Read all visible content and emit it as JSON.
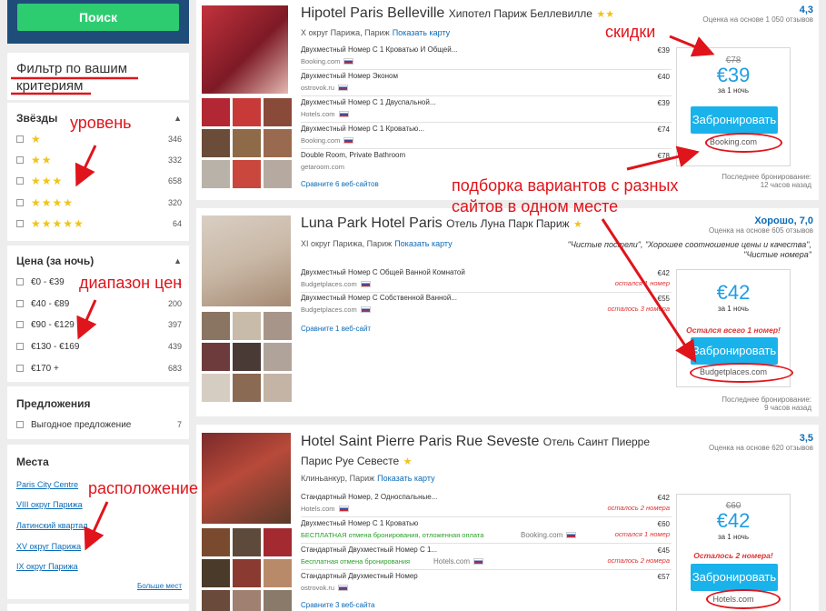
{
  "sidebar": {
    "search_label": "Поиск",
    "filter_title_1": "Фильтр по вашим",
    "filter_title_2": "критериям",
    "stars": {
      "title": "Звёзды",
      "items": [
        {
          "stars": "★",
          "count": "346"
        },
        {
          "stars": "★★",
          "count": "332"
        },
        {
          "stars": "★★★",
          "count": "658"
        },
        {
          "stars": "★★★★",
          "count": "320"
        },
        {
          "stars": "★★★★★",
          "count": "64"
        }
      ]
    },
    "price": {
      "title": "Цена (за ночь)",
      "items": [
        {
          "label": "€0 - €39",
          "count": "1"
        },
        {
          "label": "€40 - €89",
          "count": "200"
        },
        {
          "label": "€90 - €129",
          "count": "397"
        },
        {
          "label": "€130 - €169",
          "count": "439"
        },
        {
          "label": "€170 +",
          "count": "683"
        }
      ]
    },
    "offers": {
      "title": "Предложения",
      "items": [
        {
          "label": "Выгодное предложение",
          "count": "7"
        }
      ]
    },
    "places": {
      "title": "Места",
      "items": [
        "Paris City Centre",
        "VIII округ Парижа",
        "Латинский квартал",
        "XV округ Парижа",
        "IX округ Парижа"
      ],
      "more": "Больше мест"
    }
  },
  "hotels": [
    {
      "name": "Hipotel Paris Belleville",
      "name_ru": "Хипотел Париж Беллевилле",
      "stars": "★★",
      "location": "X округ Парижа, Париж",
      "map_link": "Показать карту",
      "rating": "4,3",
      "reviews": "Оценка на основе 1 050 отзывов",
      "offers": [
        {
          "name": "Двухместный Номер С 1 Кроватью И Общей...",
          "site": "Booking.com",
          "price": "€39"
        },
        {
          "name": "Двухместный Номер Эконом",
          "site": "ostrovok.ru",
          "price": "€40"
        },
        {
          "name": "Двухместный Номер С 1 Двуспальной...",
          "site": "Hotels.com",
          "price": "€39"
        },
        {
          "name": "Двухместный Номер С 1 Кроватью...",
          "site": "Booking.com",
          "price": "€74"
        },
        {
          "name": "Double Room, Private Bathroom",
          "site": "getaroom.com",
          "price": "€78"
        }
      ],
      "compare": "Сравните 6 веб-сайтов",
      "old_price": "€78",
      "price": "€39",
      "per_night": "за 1 ночь",
      "book_label": "Забронировать",
      "book_site": "Booking.com",
      "last_booking": "Последнее бронирование:",
      "last_booking_time": "12 часов назад"
    },
    {
      "name": "Luna Park Hotel Paris",
      "name_ru": "Отель Луна Парк Париж",
      "stars": "★",
      "location": "XI округ Парижа, Париж",
      "map_link": "Показать карту",
      "rating": "Хорошо, 7,0",
      "reviews": "Оценка на основе 605 отзывов",
      "quote": "\"Чистые постели\", \"Хорошее соотношение цены и качества\", \"Чистые номера\"",
      "offers": [
        {
          "name": "Двухместный Номер С Общей Ванной Комнатой",
          "site": "Budgetplaces.com",
          "price": "€42",
          "left": "остался 1 номер"
        },
        {
          "name": "Двухместный Номер С Собственной Ванной...",
          "site": "Budgetplaces.com",
          "price": "€55",
          "left": "осталось 3 номера"
        }
      ],
      "compare": "Сравните 1 веб-сайт",
      "price": "€42",
      "per_night": "за 1 ночь",
      "left_note": "Остался всего 1 номер!",
      "book_label": "Забронировать",
      "book_site": "Budgetplaces.com",
      "last_booking": "Последнее бронирование:",
      "last_booking_time": "9 часов назад"
    },
    {
      "name": "Hotel Saint Pierre Paris Rue Seveste",
      "name_ru": "Отель Саинт Пиерре",
      "name_ru2": "Парис Руе Севесте",
      "stars": "★",
      "location": "Клиньанкур, Париж",
      "map_link": "Показать карту",
      "rating": "3,5",
      "reviews": "Оценка на основе 620 отзывов",
      "offers": [
        {
          "name": "Стандартный Номер, 2 Односпальные...",
          "site": "Hotels.com",
          "price": "€42",
          "left": "осталось 2 номера"
        },
        {
          "name": "Двухместный Номер С 1 Кроватью",
          "green": "БЕСПЛАТНАЯ отмена бронирования, отложенная оплата",
          "site2": "Booking.com",
          "price": "€60",
          "left": "остался 1 номер"
        },
        {
          "name": "Стандартный Двухместный Номер С 1...",
          "green": "Бесплатная отмена бронирования",
          "site2": "Hotels.com",
          "price": "€45",
          "left": "осталось 2 номера"
        },
        {
          "name": "Стандартный Двухместный Номер",
          "site": "ostrovok.ru",
          "price": "€57"
        }
      ],
      "compare": "Сравните 3 веб-сайта",
      "old_price": "€60",
      "price": "€42",
      "per_night": "за 1 ночь",
      "left_note": "Осталось 2 номера!",
      "book_label": "Забронировать",
      "book_site": "Hotels.com"
    }
  ],
  "annotations": {
    "discount": "скидки",
    "level": "уровень",
    "price_range": "диапазон цен",
    "location": "расположение",
    "aggregation_1": "подборка вариантов с разных",
    "aggregation_2": "сайтов в одном месте"
  },
  "colors": {
    "accent_red": "#e0141b",
    "price_blue": "#1f9de3",
    "button_blue": "#1ab2ea",
    "search_green": "#2ecc71",
    "star_yellow": "#f0c419"
  }
}
